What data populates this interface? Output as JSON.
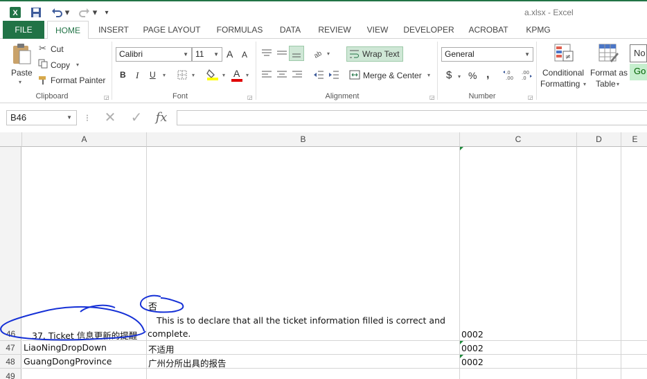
{
  "window": {
    "title": "a.xlsx - Excel"
  },
  "quick_access": {
    "more_glyph": "⁝",
    "customize_glyph": "▾"
  },
  "tabs": [
    "FILE",
    "HOME",
    "INSERT",
    "PAGE LAYOUT",
    "FORMULAS",
    "DATA",
    "REVIEW",
    "VIEW",
    "DEVELOPER",
    "ACROBAT",
    "KPMG"
  ],
  "active_tab": "HOME",
  "clipboard": {
    "paste": "Paste",
    "cut": "Cut",
    "copy": "Copy",
    "format_painter": "Format Painter",
    "label": "Clipboard"
  },
  "font": {
    "name": "Calibri",
    "size": "11",
    "bold": "B",
    "italic": "I",
    "underline": "U",
    "grow": "A",
    "shrink": "A",
    "font_color_glyph": "A",
    "label": "Font",
    "fill_color": "#ffff00",
    "font_color": "#e00000"
  },
  "alignment": {
    "wrap_text": "Wrap Text",
    "merge_center": "Merge & Center",
    "label": "Alignment"
  },
  "number": {
    "format": "General",
    "currency": "$",
    "percent": "%",
    "comma": ",",
    "inc_decimal": "←.0\n.00",
    "dec_decimal": ".00\n→.0",
    "label": "Number"
  },
  "styles": {
    "conditional_1": "Conditional",
    "conditional_2": "Formatting",
    "format_as_1": "Format as",
    "format_as_2": "Table",
    "normal": "No",
    "good": "Go"
  },
  "formula_bar": {
    "name_box": "B46",
    "fx": "fx",
    "cancel": "✕",
    "enter": "✓",
    "value": ""
  },
  "columns": [
    "A",
    "B",
    "C",
    "D",
    "E"
  ],
  "rows": [
    {
      "num": "46",
      "a": "37. Ticket 信息更新的提醒",
      "b_line1": "This is to declare that all the ticket information filled is correct and",
      "b_line2": "complete.",
      "c": "0002"
    },
    {
      "num": "47",
      "a": "LiaoNingDropDown",
      "b": "不适用",
      "c": "0002"
    },
    {
      "num": "48",
      "a": "GuangDongProvince",
      "b": "广州分所出具的报告",
      "c": "0002"
    },
    {
      "num": "49",
      "a": "",
      "b": "",
      "c": ""
    }
  ],
  "annotation": {
    "handwritten_text": "否",
    "ink_color": "#1530d6"
  },
  "colors": {
    "excel_green": "#217346",
    "comment_indicator": "#1f8a3c"
  }
}
